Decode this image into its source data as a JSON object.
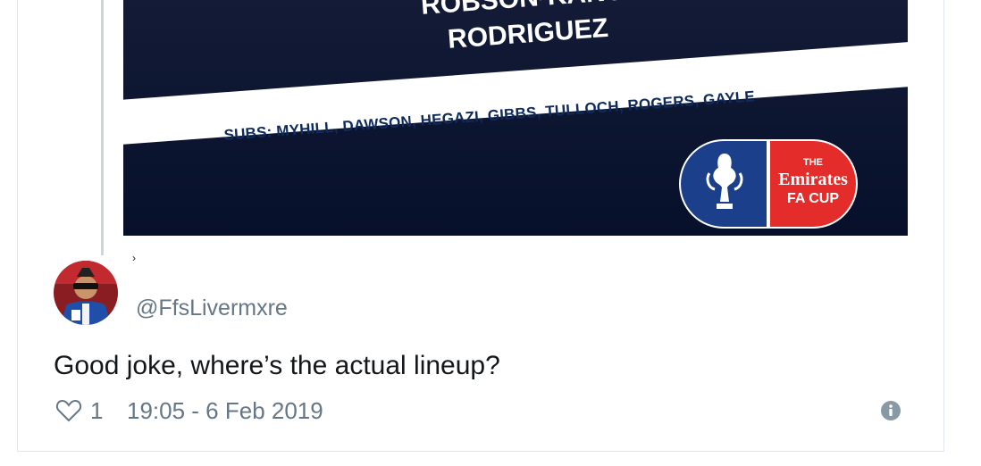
{
  "media": {
    "players": [
      "ROBSON-KANU",
      "RODRIGUEZ"
    ],
    "subs": "SUBS: MYHILL, DAWSON, HEGAZI, GIBBS, TULLOCH, ROGERS, GAYLE",
    "badge": {
      "top": "THE",
      "main": "Emirates",
      "bottom": "FA CUP"
    },
    "colors": {
      "navy": "#0b1228",
      "badge_blue": "#1b3f8a",
      "badge_red": "#e42c2b"
    }
  },
  "reply": {
    "stray_mark": "›",
    "handle": "@FfsLivermxre",
    "text": "Good joke, where’s the actual lineup?",
    "like_count": "1",
    "timestamp": "19:05 - 6 Feb 2019",
    "icons": {
      "like": "heart-icon",
      "info": "info-icon"
    }
  }
}
